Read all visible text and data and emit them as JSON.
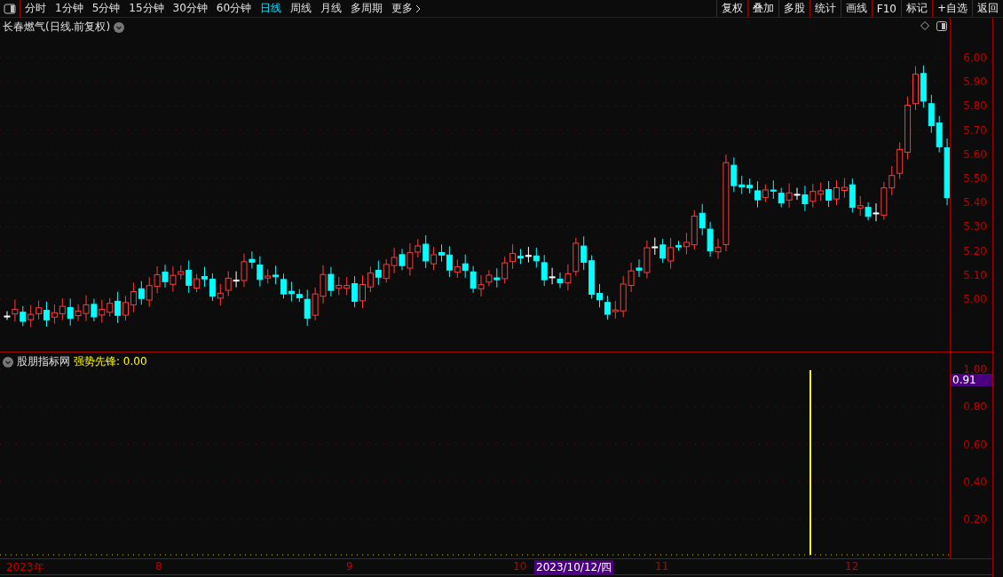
{
  "toolbar": {
    "periods": [
      {
        "label": "分时",
        "selected": false
      },
      {
        "label": "1分钟",
        "selected": false
      },
      {
        "label": "5分钟",
        "selected": false
      },
      {
        "label": "15分钟",
        "selected": false
      },
      {
        "label": "30分钟",
        "selected": false
      },
      {
        "label": "60分钟",
        "selected": false
      },
      {
        "label": "日线",
        "selected": true
      },
      {
        "label": "周线",
        "selected": false
      },
      {
        "label": "月线",
        "selected": false
      },
      {
        "label": "多周期",
        "selected": false
      }
    ],
    "more": "更多",
    "buttons": [
      "复权",
      "叠加",
      "多股",
      "统计",
      "画线",
      "F10",
      "标记",
      "+自选",
      "返回"
    ]
  },
  "price_panel": {
    "title": "长春燃气(日线.前复权)",
    "yticks": [
      "6.00",
      "5.90",
      "5.80",
      "5.70",
      "5.60",
      "5.50",
      "5.40",
      "5.30",
      "5.20",
      "5.10",
      "5.00"
    ]
  },
  "indicator_panel": {
    "source": "股朋指标网",
    "name": "强势先锋: 0.00",
    "yticks": [
      "1.00",
      "0.80",
      "0.60",
      "0.40",
      "0.20"
    ],
    "current": "0.91"
  },
  "x_axis": {
    "labels": [
      {
        "label": "2023年",
        "selected": false
      },
      {
        "label": "8",
        "selected": false
      },
      {
        "label": "9",
        "selected": false
      },
      {
        "label": "10",
        "selected": false
      },
      {
        "label": "2023/10/12/四",
        "selected": true
      },
      {
        "label": "11",
        "selected": false
      },
      {
        "label": "12",
        "selected": false
      }
    ]
  }
}
